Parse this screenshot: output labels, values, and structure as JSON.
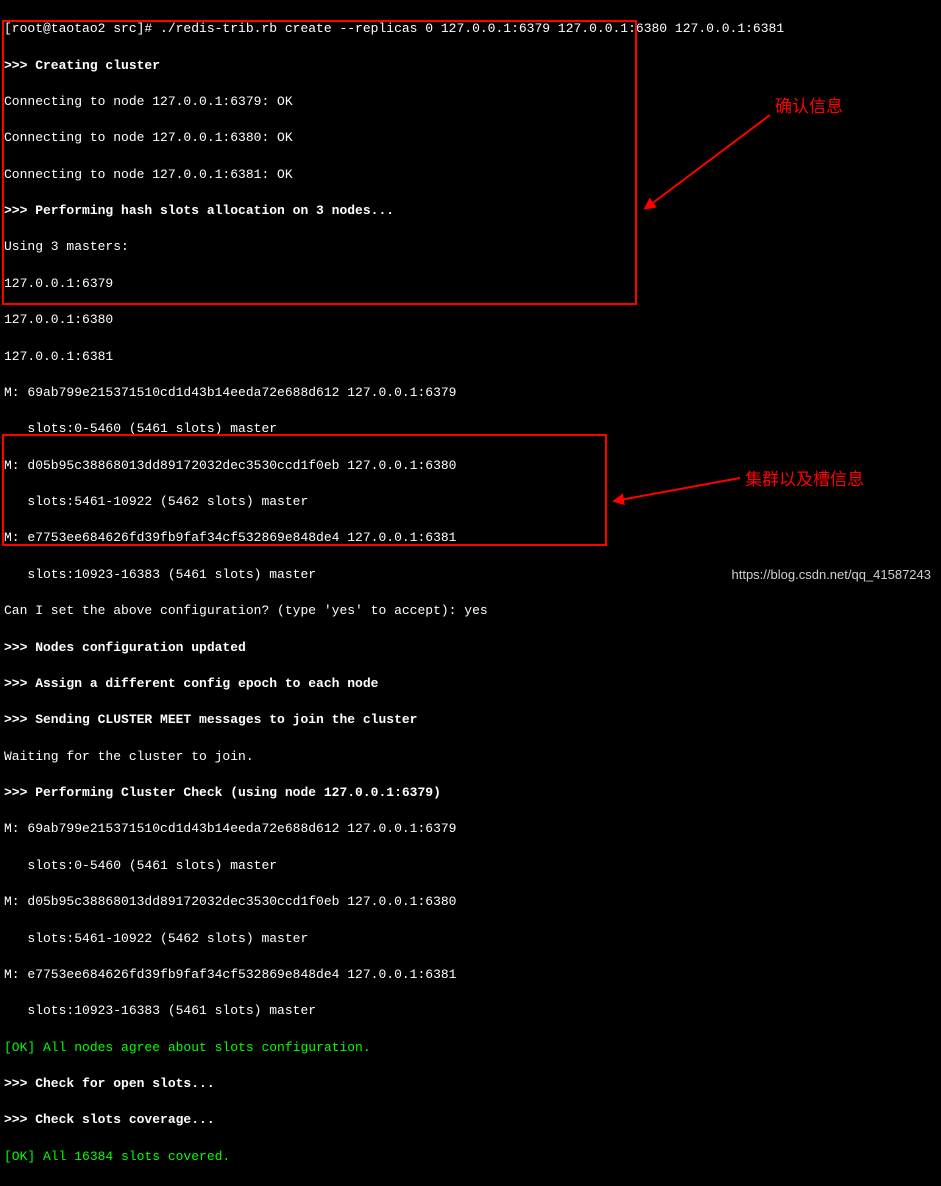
{
  "prompt": "[root@taotao2 src]# ./redis-trib.rb create --replicas 0 127.0.0.1:6379 127.0.0.1:6380 127.0.0.1:6381",
  "creating": ">>> Creating cluster",
  "conn1": "Connecting to node 127.0.0.1:6379: OK",
  "conn2": "Connecting to node 127.0.0.1:6380: OK",
  "conn3": "Connecting to node 127.0.0.1:6381: OK",
  "perform": ">>> Performing hash slots allocation on 3 nodes...",
  "using": "Using 3 masters:",
  "m1a": "127.0.0.1:6379",
  "m2a": "127.0.0.1:6380",
  "m3a": "127.0.0.1:6381",
  "n1": "M: 69ab799e215371510cd1d43b14eeda72e688d612 127.0.0.1:6379",
  "s1": "   slots:0-5460 (5461 slots) master",
  "n2": "M: d05b95c38868013dd89172032dec3530ccd1f0eb 127.0.0.1:6380",
  "s2": "   slots:5461-10922 (5462 slots) master",
  "n3": "M: e7753ee684626fd39fb9faf34cf532869e848de4 127.0.0.1:6381",
  "s3": "   slots:10923-16383 (5461 slots) master",
  "confirm": "Can I set the above configuration? (type 'yes' to accept): yes",
  "updated": ">>> Nodes configuration updated",
  "assign": ">>> Assign a different config epoch to each node",
  "meet": ">>> Sending CLUSTER MEET messages to join the cluster",
  "waiting": "Waiting for the cluster to join.",
  "check": ">>> Performing Cluster Check (using node 127.0.0.1:6379)",
  "cn1": "M: 69ab799e215371510cd1d43b14eeda72e688d612 127.0.0.1:6379",
  "cs1": "   slots:0-5460 (5461 slots) master",
  "cn2": "M: d05b95c38868013dd89172032dec3530ccd1f0eb 127.0.0.1:6380",
  "cs2": "   slots:5461-10922 (5462 slots) master",
  "cn3": "M: e7753ee684626fd39fb9faf34cf532869e848de4 127.0.0.1:6381",
  "cs3": "   slots:10923-16383 (5461 slots) master",
  "ok1": "[OK] All nodes agree about slots configuration.",
  "chk1": ">>> Check for open slots...",
  "chk2": ">>> Check slots coverage...",
  "ok2": "[OK] All 16384 slots covered.",
  "annotation1": "确认信息",
  "annotation2": "集群以及槽信息",
  "watermark": "https://blog.csdn.net/qq_41587243"
}
